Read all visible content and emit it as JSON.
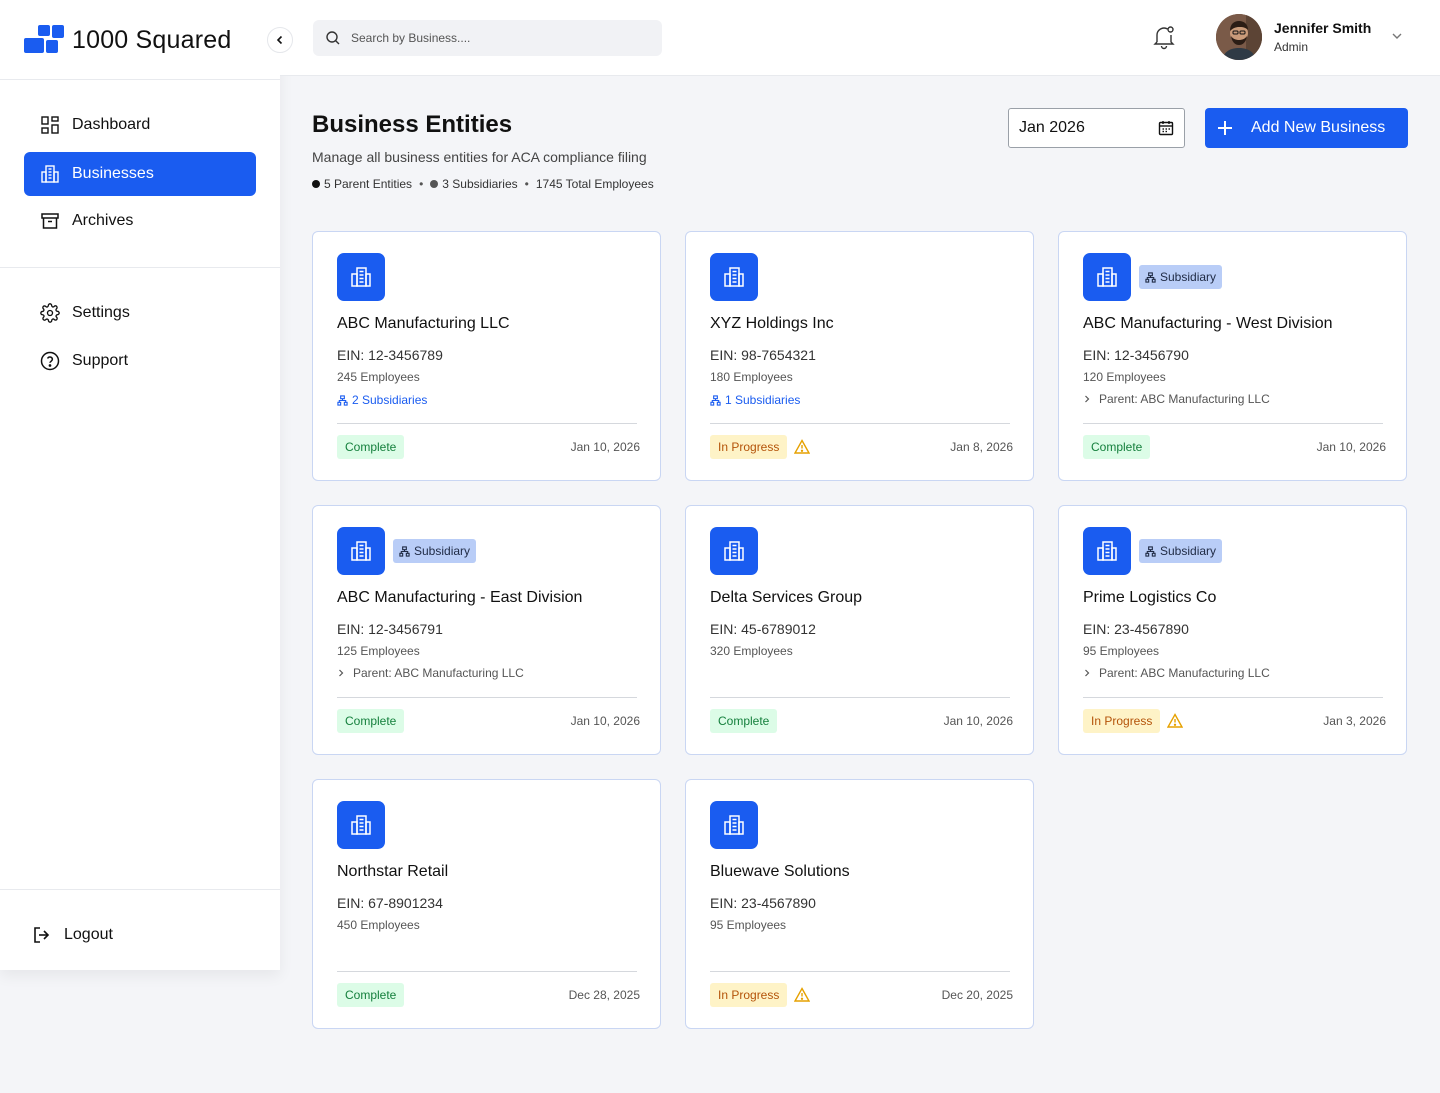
{
  "app": {
    "name": "1000 Squared"
  },
  "sidebar": {
    "items": [
      {
        "label": "Dashboard",
        "icon": "grid-icon"
      },
      {
        "label": "Businesses",
        "icon": "building-icon",
        "active": true
      },
      {
        "label": "Archives",
        "icon": "archive-icon"
      },
      {
        "label": "Settings",
        "icon": "gear-icon"
      },
      {
        "label": "Support",
        "icon": "help-circle-icon"
      }
    ],
    "logout": "Logout"
  },
  "topbar": {
    "search_placeholder": "Search by Business....",
    "user": {
      "name": "Jennifer Smith",
      "role": "Admin"
    }
  },
  "header": {
    "title": "Business Entities",
    "subtitle": "Manage all business entities for ACA compliance filing",
    "stats": {
      "parents": "5 Parent Entities",
      "subsidiaries": "3 Subsidiaries",
      "employees": "1745 Total Employees"
    },
    "date_value": "Jan 2026",
    "add_button": "Add New Business"
  },
  "colors": {
    "primary": "#1a5cf0",
    "complete": "#15803d",
    "progress": "#b45309"
  },
  "businesses": [
    {
      "name": "ABC Manufacturing LLC",
      "ein": "EIN: 12-3456789",
      "employees": "245 Employees",
      "subsidiaries": "2 Subsidiaries",
      "status": "Complete",
      "date": "Jan 10, 2026"
    },
    {
      "name": "XYZ Holdings Inc",
      "ein": "EIN: 98-7654321",
      "employees": "180 Employees",
      "subsidiaries": "1 Subsidiaries",
      "status": "In Progress",
      "date": "Jan 8, 2026"
    },
    {
      "name": "ABC Manufacturing - West Division",
      "badge": "Subsidiary",
      "ein": "EIN: 12-3456790",
      "employees": "120 Employees",
      "parent": "Parent: ABC Manufacturing LLC",
      "status": "Complete",
      "date": "Jan 10, 2026"
    },
    {
      "name": "ABC Manufacturing - East Division",
      "badge": "Subsidiary",
      "ein": "EIN: 12-3456791",
      "employees": "125 Employees",
      "parent": "Parent: ABC Manufacturing LLC",
      "status": "Complete",
      "date": "Jan 10, 2026"
    },
    {
      "name": "Delta Services Group",
      "ein": "EIN: 45-6789012",
      "employees": "320 Employees",
      "status": "Complete",
      "date": "Jan 10, 2026"
    },
    {
      "name": "Prime Logistics Co",
      "badge": "Subsidiary",
      "ein": "EIN: 23-4567890",
      "employees": "95 Employees",
      "parent": "Parent: ABC Manufacturing LLC",
      "status": "In Progress",
      "date": "Jan 3, 2026"
    },
    {
      "name": "Northstar Retail",
      "ein": "EIN: 67-8901234",
      "employees": "450 Employees",
      "status": "Complete",
      "date": "Dec 28, 2025"
    },
    {
      "name": "Bluewave Solutions",
      "ein": "EIN: 23-4567890",
      "employees": "95 Employees",
      "status": "In Progress",
      "date": "Dec 20, 2025"
    }
  ]
}
